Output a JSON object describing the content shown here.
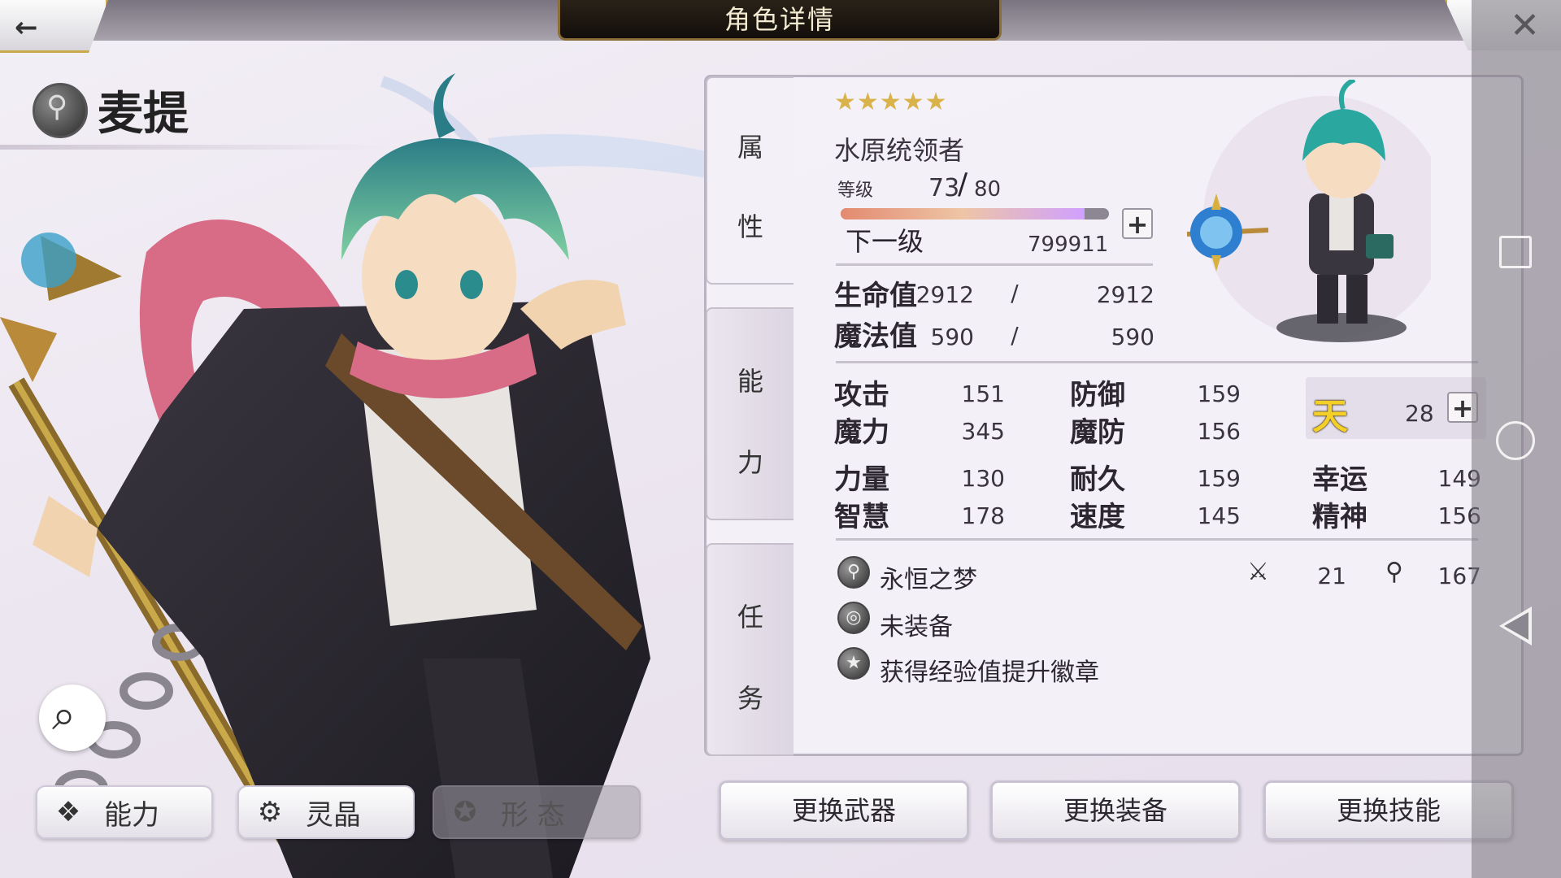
{
  "header": {
    "title": "角色详情",
    "back_icon": "←",
    "close_icon": "✕"
  },
  "character": {
    "name": "麦提",
    "rarity_stars": "★★★★★",
    "class": "水原统领者",
    "level_label": "等级",
    "level_current": "73",
    "level_max": "80",
    "level_progress": 0.91,
    "next_level_label": "下一级",
    "next_level_exp": "799911"
  },
  "side_tabs": [
    {
      "chars": [
        "属",
        "性"
      ]
    },
    {
      "chars": [
        "能",
        "力"
      ]
    },
    {
      "chars": [
        "任",
        "务"
      ]
    }
  ],
  "vitals": {
    "hp_label": "生命值",
    "hp_current": "2912",
    "hp_max": "2912",
    "mp_label": "魔法值",
    "mp_current": "590",
    "mp_max": "590",
    "separator": "/"
  },
  "stats": {
    "atk_label": "攻击",
    "atk": "151",
    "def_label": "防御",
    "def": "159",
    "mag_label": "魔力",
    "mag": "345",
    "mdef_label": "魔防",
    "mdef": "156",
    "str_label": "力量",
    "str": "130",
    "end_label": "耐久",
    "end": "159",
    "luck_label": "幸运",
    "luck": "149",
    "int_label": "智慧",
    "int": "178",
    "spd_label": "速度",
    "spd": "145",
    "spirit_label": "精神",
    "spirit": "156"
  },
  "heaven": {
    "icon": "天",
    "value": "28"
  },
  "equipment": {
    "weapon_name": "永恒之梦",
    "weapon_atk": "21",
    "weapon_mag": "167",
    "accessory": "未装备",
    "badge": "获得经验值提升徽章"
  },
  "bottom_tabs": {
    "ability": "能力",
    "crystal": "灵晶",
    "form": "形 态"
  },
  "actions": {
    "weapon": "更换武器",
    "equip": "更换装备",
    "skill": "更换技能"
  },
  "colors": {
    "gold_accent": "#c9a94a",
    "panel_bg": "#f4f0f8",
    "heaven_yellow": "#f3cf28"
  }
}
